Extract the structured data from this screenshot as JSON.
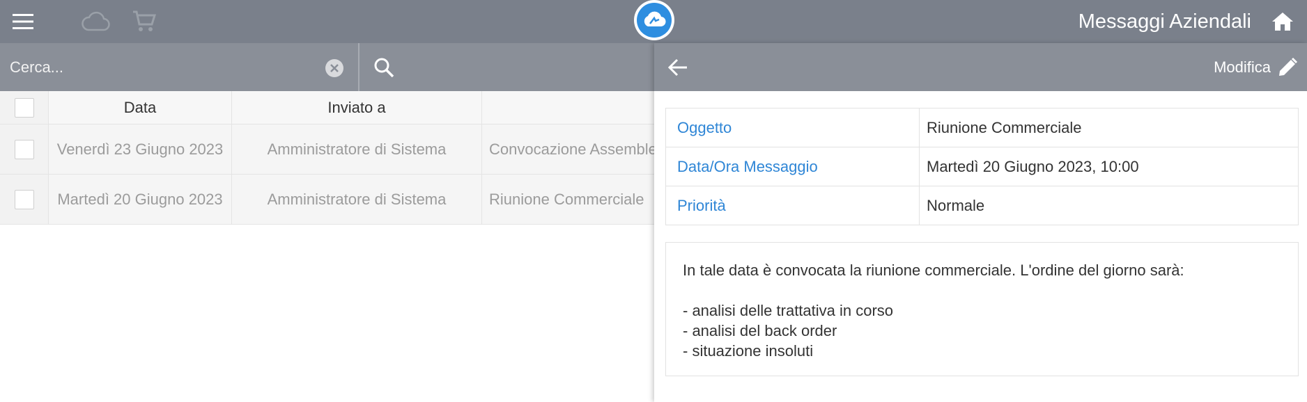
{
  "header": {
    "app_title": "Messaggi Aziendali",
    "icons": {
      "menu": "hamburger-menu-icon",
      "cloud": "cloud-outline-icon",
      "cart": "shopping-cart-icon",
      "logo": "cloud-logo-icon",
      "home": "home-icon"
    }
  },
  "search": {
    "placeholder": "Cerca...",
    "value": ""
  },
  "table": {
    "columns": [
      "",
      "Data",
      "Inviato a",
      ""
    ],
    "rows": [
      {
        "date": "Venerdì 23 Giugno 2023",
        "sent_to": "Amministratore di Sistema",
        "subject": "Convocazione Assemblea"
      },
      {
        "date": "Martedì 20 Giugno 2023",
        "sent_to": "Amministratore di Sistema",
        "subject": "Riunione Commerciale"
      }
    ]
  },
  "detail": {
    "edit_label": "Modifica",
    "fields": [
      {
        "label": "Oggetto",
        "value": "Riunione Commerciale"
      },
      {
        "label": "Data/Ora Messaggio",
        "value": "Martedì 20 Giugno 2023, 10:00"
      },
      {
        "label": "Priorità",
        "value": "Normale"
      }
    ],
    "body": "In tale data è convocata la riunione commerciale. L'ordine del giorno sarà:\n\n- analisi delle trattativa in corso\n- analisi del back order\n- situazione insoluti"
  },
  "colors": {
    "topbar": "#7a808b",
    "searchbar": "#8a8f98",
    "link_blue": "#2f86d6",
    "logo_blue": "#2e8ee0"
  }
}
